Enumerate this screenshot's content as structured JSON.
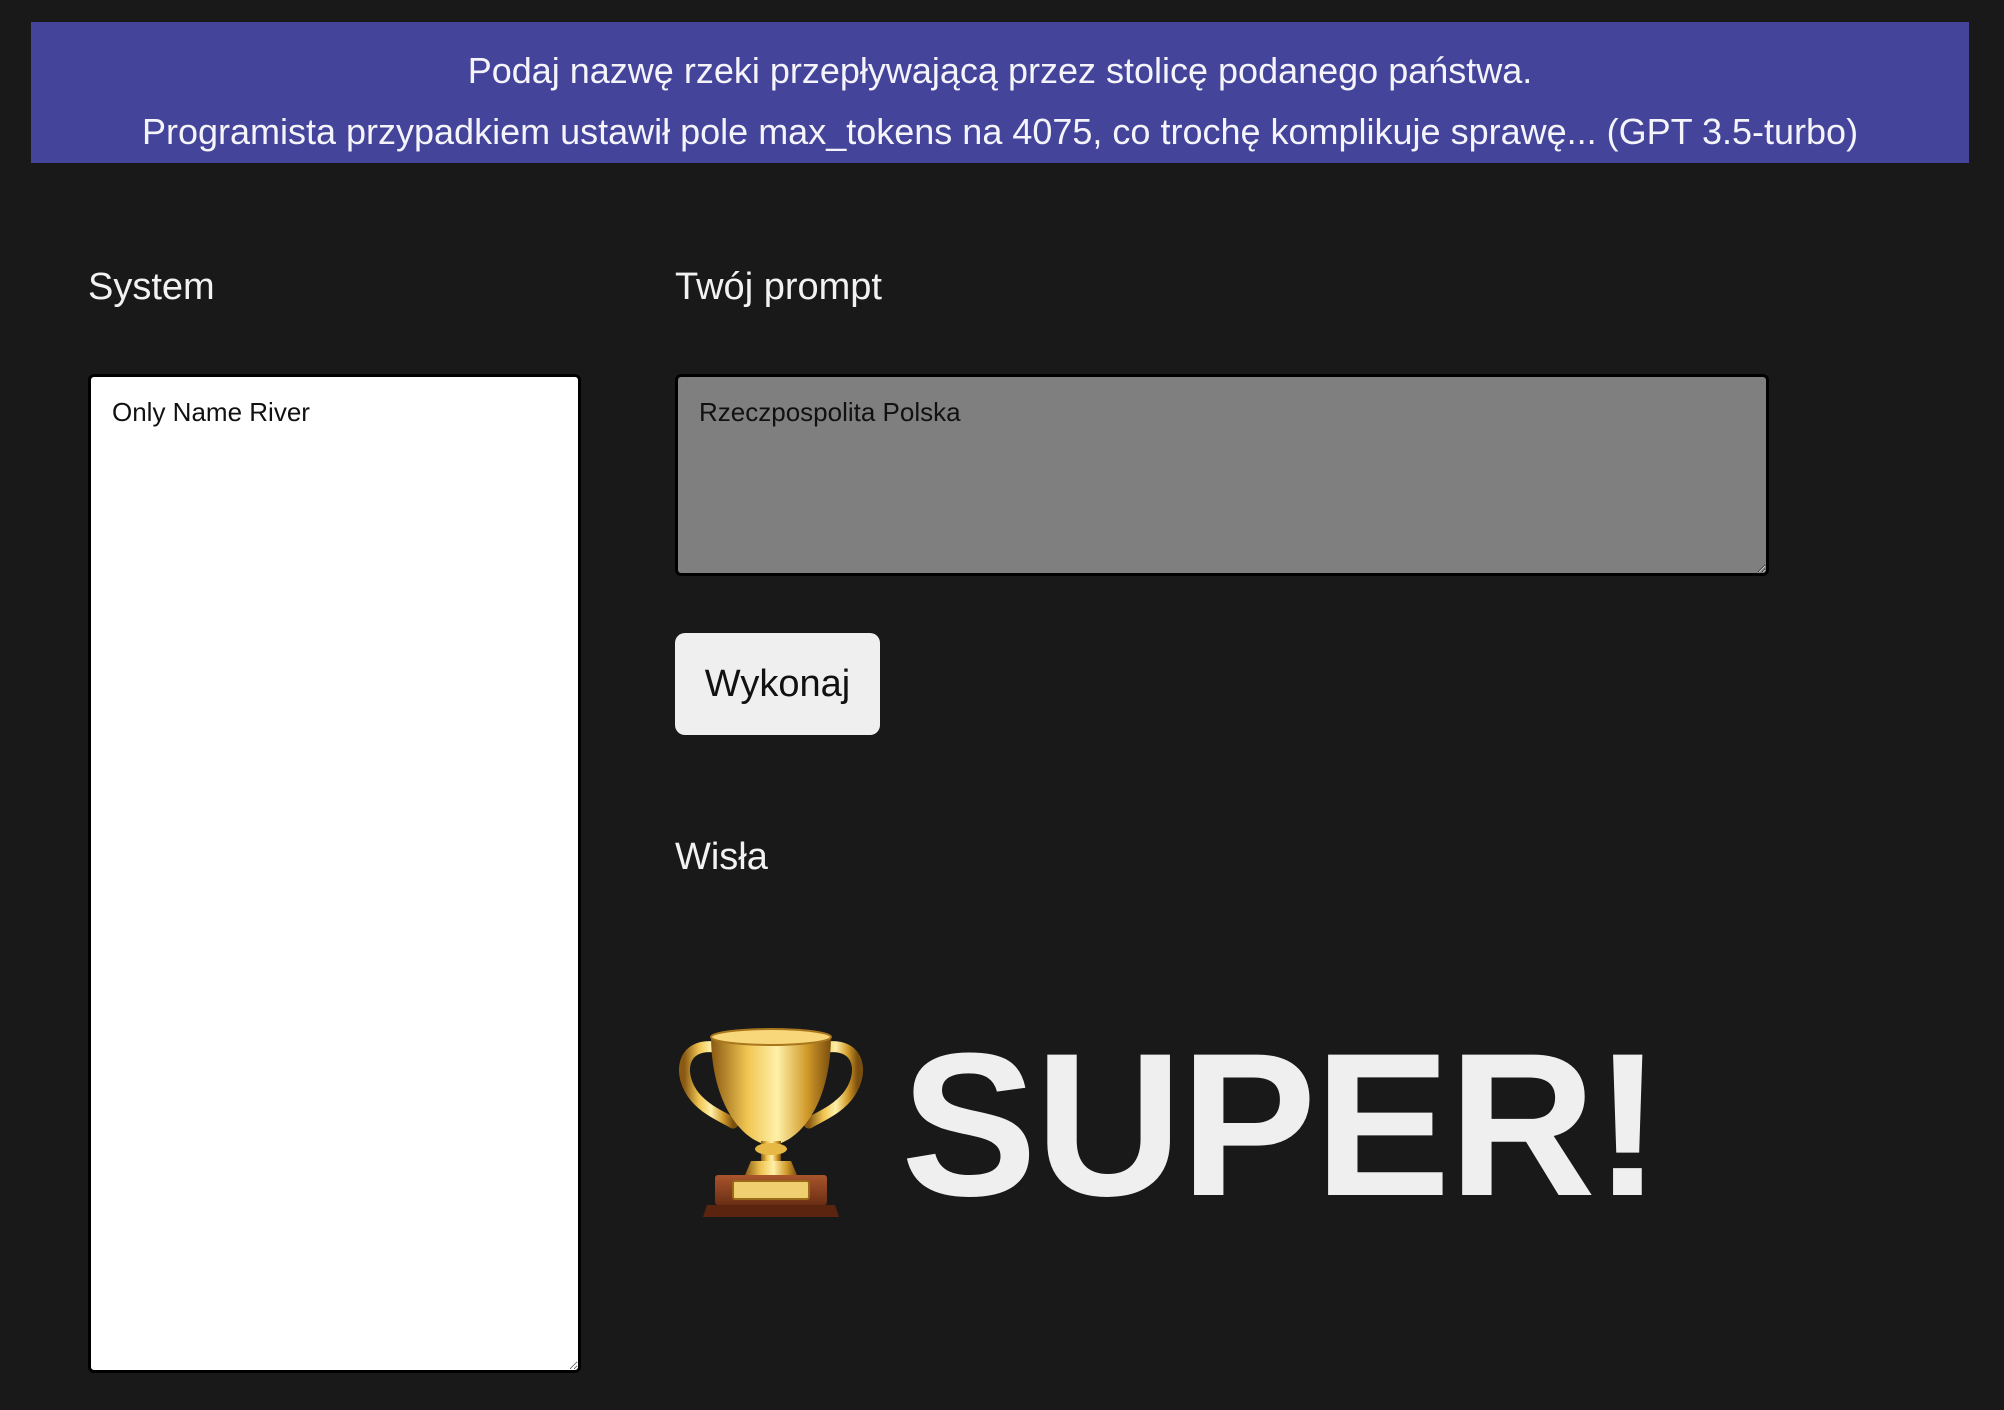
{
  "banner": {
    "line1": "Podaj nazwę rzeki przepływającą przez stolicę podanego państwa.",
    "line2": "Programista przypadkiem ustawił pole max_tokens na 4075, co trochę komplikuje sprawę... (GPT 3.5-turbo)",
    "background_color": "#43449a"
  },
  "system": {
    "label": "System",
    "value": "Only Name River"
  },
  "prompt": {
    "label": "Twój prompt",
    "value": "Rzeczpospolita Polska"
  },
  "run_button": {
    "label": "Wykonaj"
  },
  "result": {
    "text": "Wisła"
  },
  "success": {
    "icon": "trophy-icon",
    "text": "SUPER!"
  },
  "colors": {
    "page_background": "#191919",
    "prompt_background": "#7f7f7f",
    "button_background": "#efefef"
  }
}
